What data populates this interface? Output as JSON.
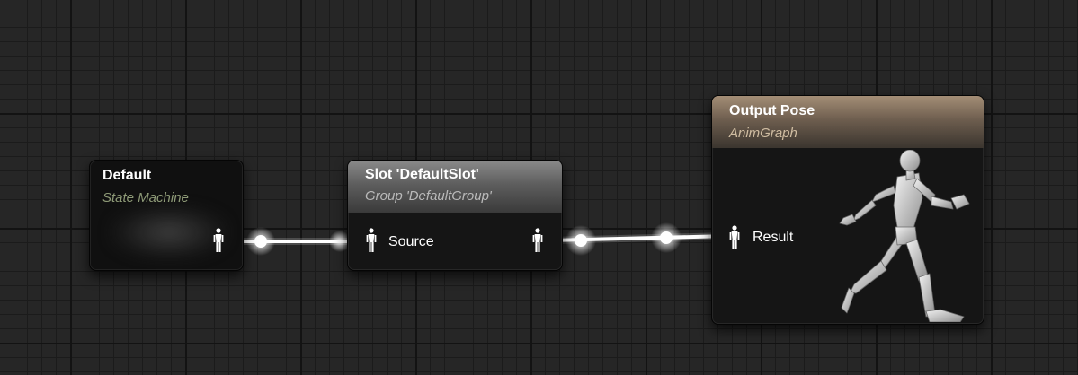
{
  "colors": {
    "canvas_background": "#262626",
    "grid_major": "#131313",
    "grid_minor": "#1b1b1b",
    "wire": "#ffffff",
    "node_body": "#151515",
    "slot_header": "#6e6e6e",
    "output_header": "#8a7764",
    "state_machine_subtitle": "#8e9a77",
    "output_subtitle": "#d0bda2"
  },
  "nodes": {
    "default": {
      "title": "Default",
      "subtitle": "State Machine",
      "output_pin_icon": "pose-pin-icon"
    },
    "slot": {
      "title": "Slot 'DefaultSlot'",
      "subtitle": "Group 'DefaultGroup'",
      "input_pin_label": "Source",
      "input_pin_icon": "pose-pin-icon",
      "output_pin_icon": "pose-pin-icon"
    },
    "output_pose": {
      "title": "Output Pose",
      "subtitle": "AnimGraph",
      "input_pin_label": "Result",
      "input_pin_icon": "pose-pin-icon",
      "preview_icon": "running-mannequin-icon"
    }
  },
  "connections": [
    {
      "from": "Default",
      "to": "Source"
    },
    {
      "from": "Slot 'DefaultSlot'",
      "to": "Result"
    }
  ]
}
